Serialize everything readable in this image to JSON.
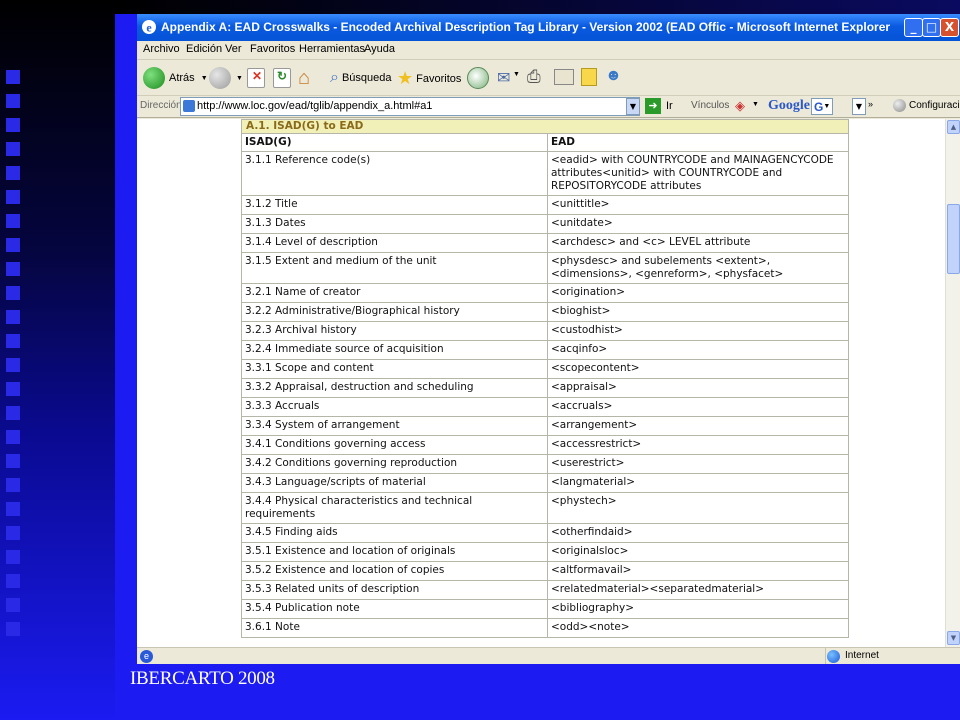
{
  "window": {
    "title": "Appendix A: EAD Crosswalks - Encoded Archival Description Tag Library - Version 2002 (EAD Offic - Microsoft Internet Explorer",
    "controls": [
      "_",
      "□",
      "X"
    ]
  },
  "menubar": {
    "items": [
      "Archivo",
      "Edición",
      "Ver",
      "Favoritos",
      "Herramientas",
      "Ayuda"
    ]
  },
  "toolbar": {
    "back_label": "Atrás",
    "search_label": "Búsqueda",
    "favorites_label": "Favoritos"
  },
  "addressbar": {
    "label": "Dirección",
    "url": "http://www.loc.gov/ead/tglib/appendix_a.html#a1",
    "go_label": "Ir",
    "links_label": "Vínculos",
    "google_label": "Google",
    "config_label": "Configuració"
  },
  "statusbar": {
    "zone": "Internet"
  },
  "table": {
    "caption": "A.1. ISAD(G) to EAD",
    "headers": [
      "ISAD(G)",
      "EAD"
    ],
    "rows": [
      [
        "3.1.1 Reference code(s)",
        "<eadid> with COUNTRYCODE and MAINAGENCYCODE attributes<unitid> with COUNTRYCODE and REPOSITORYCODE attributes"
      ],
      [
        "3.1.2 Title",
        "<unittitle>"
      ],
      [
        "3.1.3 Dates",
        "<unitdate>"
      ],
      [
        "3.1.4 Level of description",
        "<archdesc> and <c> LEVEL attribute"
      ],
      [
        "3.1.5 Extent and medium of the unit",
        "<physdesc> and subelements <extent>, <dimensions>, <genreform>, <physfacet>"
      ],
      [
        "3.2.1 Name of creator",
        "<origination>"
      ],
      [
        "3.2.2 Administrative/Biographical history",
        "<bioghist>"
      ],
      [
        "3.2.3 Archival history",
        "<custodhist>"
      ],
      [
        "3.2.4 Immediate source of acquisition",
        "<acqinfo>"
      ],
      [
        "3.3.1 Scope and content",
        "<scopecontent>"
      ],
      [
        "3.3.2 Appraisal, destruction and scheduling",
        "<appraisal>"
      ],
      [
        "3.3.3 Accruals",
        "<accruals>"
      ],
      [
        "3.3.4 System of arrangement",
        "<arrangement>"
      ],
      [
        "3.4.1 Conditions governing access",
        "<accessrestrict>"
      ],
      [
        "3.4.2 Conditions governing reproduction",
        "<userestrict>"
      ],
      [
        "3.4.3 Language/scripts of material",
        "<langmaterial>"
      ],
      [
        "3.4.4 Physical characteristics and technical requirements",
        "<phystech>"
      ],
      [
        "3.4.5 Finding aids",
        "<otherfindaid>"
      ],
      [
        "3.5.1 Existence and location of originals",
        "<originalsloc>"
      ],
      [
        "3.5.2 Existence and location of copies",
        "<altformavail>"
      ],
      [
        "3.5.3 Related units of description",
        "<relatedmaterial><separatedmaterial>"
      ],
      [
        "3.5.4 Publication note",
        "<bibliography>"
      ],
      [
        "3.6.1 Note",
        "<odd><note>"
      ]
    ]
  },
  "slide": {
    "footer": "IBERCARTO 2008"
  }
}
